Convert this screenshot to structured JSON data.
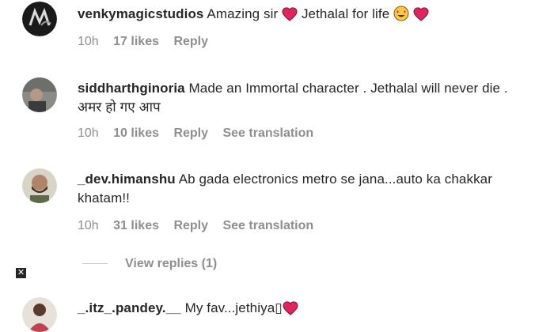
{
  "comments": [
    {
      "username": "venkymagicstudios",
      "text_parts": [
        "Amazing sir ",
        " Jethalal for life "
      ],
      "time": "10h",
      "likes": "17 likes",
      "reply": "Reply",
      "translation": ""
    },
    {
      "username": "siddharthginoria",
      "text": "Made an Immortal character . Jethalal will never die . अमर हो गए आप",
      "time": "10h",
      "likes": "10 likes",
      "reply": "Reply",
      "translation": "See translation"
    },
    {
      "username": "_dev.himanshu",
      "text": "Ab gada electronics metro se jana...auto ka chakkar khatam!!",
      "time": "10h",
      "likes": "31 likes",
      "reply": "Reply",
      "translation": "See translation"
    },
    {
      "username": "_.itz_.pandey.__",
      "text": "My fav...jethiya",
      "placeholder_glyph": "▯"
    }
  ],
  "view_replies": "View replies (1)",
  "close_glyph": "✕",
  "colors": {
    "heart": "#e0245e",
    "meta": "#8e8e8e",
    "text": "#262626"
  },
  "icons": [
    "heart-icon",
    "heart-eyes-emoji-icon",
    "close-icon"
  ]
}
